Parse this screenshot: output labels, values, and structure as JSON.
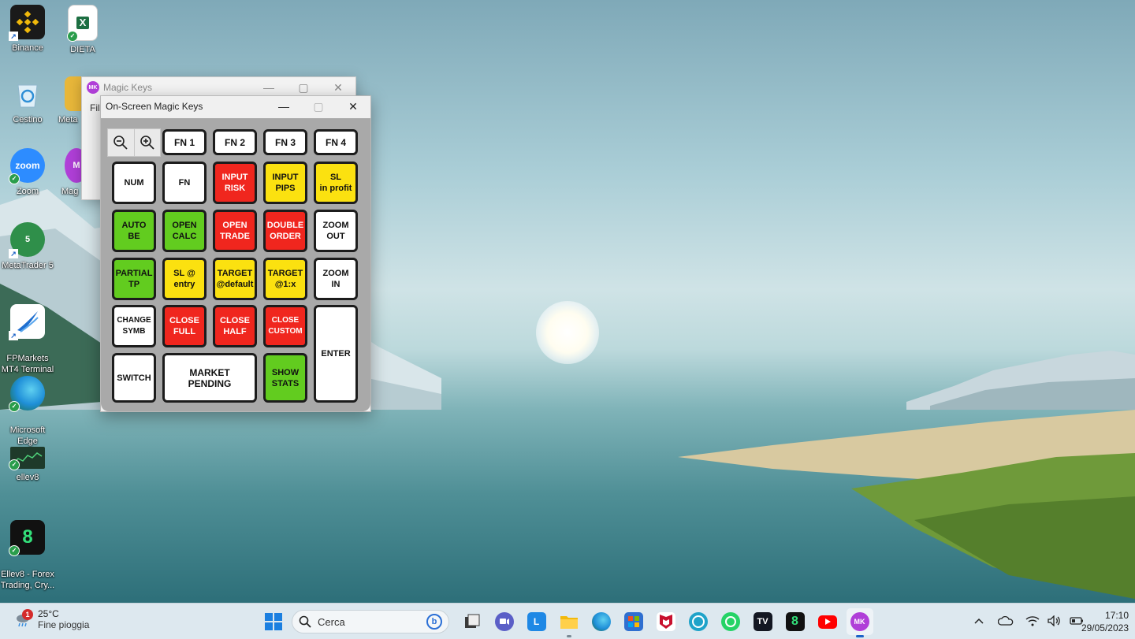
{
  "desktop": {
    "icons": [
      {
        "label": "Binance",
        "icon": "binance-icon",
        "color": "#1a1a1a"
      },
      {
        "label": "DIETA",
        "icon": "excel-file-icon",
        "color": "#1d6f42"
      },
      {
        "label": "Cestino",
        "icon": "recycle-bin-icon",
        "color": "#6cb6e6"
      },
      {
        "label": "Meta",
        "icon": "metaeditor-icon",
        "color": "#e8b73a"
      },
      {
        "label": "Zoom",
        "icon": "zoom-icon",
        "color": "#2d8cff",
        "glyph": "zoom"
      },
      {
        "label": "Mag",
        "icon": "magic-keys-icon",
        "color": "#b03fd8",
        "glyph": "M"
      },
      {
        "label": "MetaTrader 5",
        "icon": "metatrader5-icon",
        "color": "#2f8f4a",
        "glyph": "5"
      },
      {
        "label": "FPMarkets\nMT4 Terminal",
        "icon": "fpmarkets-icon",
        "color": "#ffffff"
      },
      {
        "label": "Microsoft\nEdge",
        "icon": "edge-icon",
        "color": "#1f8fd8"
      },
      {
        "label": "ellev8",
        "icon": "ellev8-chart-icon",
        "color": "#1e3a2a"
      },
      {
        "label": "Ellev8 - Forex\nTrading, Cry...",
        "icon": "ellev8-app-icon",
        "color": "#111111",
        "glyph": "8"
      }
    ]
  },
  "back_window": {
    "title": "Magic Keys",
    "badge": "MK",
    "menu_first": "Fil"
  },
  "front_window": {
    "title": "On-Screen Magic Keys",
    "controls": {
      "minimize": "—",
      "maximize": "▢",
      "close": "✕"
    }
  },
  "keypad": {
    "fn_keys": [
      "FN 1",
      "FN 2",
      "FN 3",
      "FN 4"
    ],
    "keys": [
      {
        "id": "num",
        "label": "NUM",
        "color": "white"
      },
      {
        "id": "fn",
        "label": "FN",
        "color": "white"
      },
      {
        "id": "input-risk",
        "label": "INPUT\nRISK",
        "color": "red"
      },
      {
        "id": "input-pips",
        "label": "INPUT\nPIPS",
        "color": "yellow"
      },
      {
        "id": "sl-in-profit",
        "label": "SL\nin profit",
        "color": "yellow"
      },
      {
        "id": "auto-be",
        "label": "AUTO\nBE",
        "color": "green"
      },
      {
        "id": "open-calc",
        "label": "OPEN\nCALC",
        "color": "green"
      },
      {
        "id": "open-trade",
        "label": "OPEN\nTRADE",
        "color": "red"
      },
      {
        "id": "double-order",
        "label": "DOUBLE\nORDER",
        "color": "red"
      },
      {
        "id": "zoom-out",
        "label": "ZOOM\nOUT",
        "color": "white"
      },
      {
        "id": "partial-tp",
        "label": "PARTIAL\nTP",
        "color": "green"
      },
      {
        "id": "sl-at-entry",
        "label": "SL @\nentry",
        "color": "yellow"
      },
      {
        "id": "target-default",
        "label": "TARGET\n@default",
        "color": "yellow"
      },
      {
        "id": "target-1x",
        "label": "TARGET\n@1:x",
        "color": "yellow"
      },
      {
        "id": "zoom-in",
        "label": "ZOOM\nIN",
        "color": "white"
      },
      {
        "id": "change-symb",
        "label": "CHANGE\nSYMB",
        "color": "white"
      },
      {
        "id": "close-full",
        "label": "CLOSE\nFULL",
        "color": "red"
      },
      {
        "id": "close-half",
        "label": "CLOSE\nHALF",
        "color": "red"
      },
      {
        "id": "close-custom",
        "label": "CLOSE\nCUSTOM",
        "color": "red"
      },
      {
        "id": "enter",
        "label": "ENTER",
        "color": "white"
      },
      {
        "id": "switch",
        "label": "SWITCH",
        "color": "white"
      },
      {
        "id": "market-pending",
        "label": "MARKET\nPENDING",
        "color": "white"
      },
      {
        "id": "show-stats",
        "label": "SHOW\nSTATS",
        "color": "green"
      }
    ],
    "colors": {
      "white": "#ffffff",
      "red": "#f0261e",
      "yellow": "#fbe110",
      "green": "#62cc1f"
    }
  },
  "taskbar": {
    "weather": {
      "temp": "25°C",
      "condition": "Fine pioggia",
      "badge": "1"
    },
    "search_label": "Cerca",
    "apps": [
      {
        "name": "task-view",
        "icon": "task-view-icon",
        "color": "#3a3a3a",
        "glyph": ""
      },
      {
        "name": "teams-chat",
        "icon": "chat-icon",
        "color": "#5b5fc7",
        "glyph": ""
      },
      {
        "name": "l-app",
        "icon": "l-app-icon",
        "color": "#1e88e5",
        "glyph": "L"
      },
      {
        "name": "file-explorer",
        "icon": "folder-icon",
        "color": "#f2b90c",
        "glyph": ""
      },
      {
        "name": "edge",
        "icon": "edge-icon",
        "color": "#1f8fd8",
        "glyph": ""
      },
      {
        "name": "microsoft-store",
        "icon": "store-icon",
        "color": "#2f6fd0",
        "glyph": ""
      },
      {
        "name": "mcafee",
        "icon": "mcafee-icon",
        "color": "#c8102e",
        "glyph": ""
      },
      {
        "name": "alexa",
        "icon": "alexa-icon",
        "color": "#1fa3c9",
        "glyph": ""
      },
      {
        "name": "whatsapp",
        "icon": "whatsapp-icon",
        "color": "#25d366",
        "glyph": ""
      },
      {
        "name": "tradingview",
        "icon": "tradingview-icon",
        "color": "#131722",
        "glyph": "TV"
      },
      {
        "name": "ellev8",
        "icon": "ellev8-app-icon",
        "color": "#111111",
        "glyph": "8"
      },
      {
        "name": "youtube",
        "icon": "youtube-icon",
        "color": "#ff0000",
        "glyph": ""
      },
      {
        "name": "magic-keys",
        "icon": "magic-keys-icon",
        "color": "#b03fd8",
        "glyph": "MK"
      }
    ],
    "clock": {
      "time": "17:10",
      "date": "29/05/2023"
    }
  }
}
